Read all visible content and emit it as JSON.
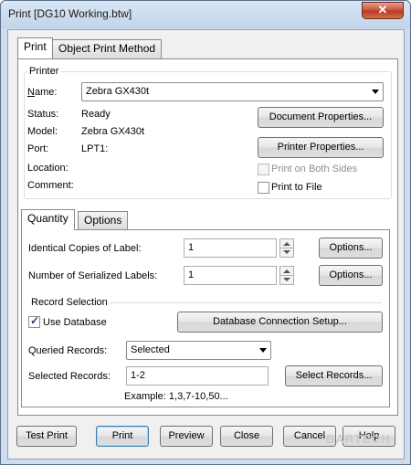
{
  "window": {
    "title": "Print [DG10 Working.btw]",
    "close_symbol": "✕"
  },
  "main_tabs": [
    "Print",
    "Object Print Method"
  ],
  "printer": {
    "group_label": "Printer",
    "name_label": "Name:",
    "name_value": "Zebra  GX430t",
    "status_label": "Status:",
    "status_value": "Ready",
    "model_label": "Model:",
    "model_value": "Zebra  GX430t",
    "port_label": "Port:",
    "port_value": "LPT1:",
    "location_label": "Location:",
    "comment_label": "Comment:",
    "document_properties": "Document Properties...",
    "printer_properties": "Printer Properties...",
    "print_both_sides": "Print on Both Sides",
    "print_to_file": "Print to File"
  },
  "sub_tabs": [
    "Quantity",
    "Options"
  ],
  "quantity": {
    "identical_copies_label": "Identical Copies of Label:",
    "identical_copies_value": "1",
    "serialized_labels_label": "Number of Serialized Labels:",
    "serialized_labels_value": "1",
    "options_button": "Options...",
    "record_selection_label": "Record Selection",
    "use_database_label": "Use Database",
    "db_setup_button": "Database Connection Setup...",
    "queried_records_label": "Queried Records:",
    "queried_records_value": "Selected",
    "selected_records_label": "Selected Records:",
    "selected_records_value": "1-2",
    "select_records_button": "Select Records...",
    "example_text": "Example: 1,3,7-10,50..."
  },
  "footer": {
    "test_print": "Test Print",
    "print": "Print",
    "preview": "Preview",
    "close": "Close",
    "cancel": "Cancel",
    "help": "Help",
    "watermark": "BARTECH"
  }
}
